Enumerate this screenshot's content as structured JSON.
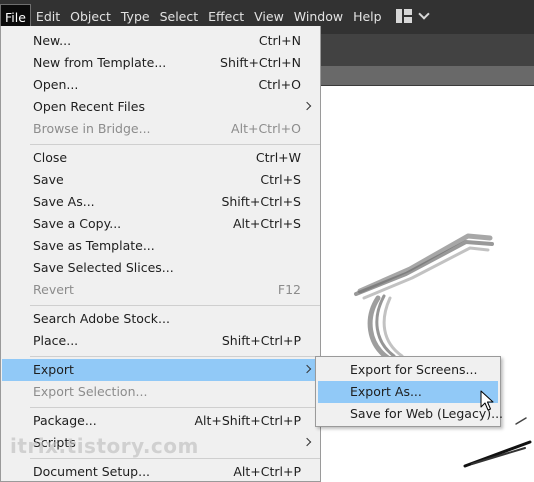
{
  "menubar": {
    "items": [
      "File",
      "Edit",
      "Object",
      "Type",
      "Select",
      "Effect",
      "View",
      "Window",
      "Help"
    ],
    "active": "File",
    "workspace_icon": "workspace-layout-icon"
  },
  "file_menu": {
    "items": [
      {
        "label": "New...",
        "shortcut": "Ctrl+N",
        "state": "enabled"
      },
      {
        "label": "New from Template...",
        "shortcut": "Shift+Ctrl+N",
        "state": "enabled"
      },
      {
        "label": "Open...",
        "shortcut": "Ctrl+O",
        "state": "enabled"
      },
      {
        "label": "Open Recent Files",
        "shortcut": "",
        "submenu": true,
        "state": "enabled"
      },
      {
        "label": "Browse in Bridge...",
        "shortcut": "Alt+Ctrl+O",
        "state": "disabled"
      },
      {
        "label": "Close",
        "shortcut": "Ctrl+W",
        "state": "enabled"
      },
      {
        "label": "Save",
        "shortcut": "Ctrl+S",
        "state": "enabled"
      },
      {
        "label": "Save As...",
        "shortcut": "Shift+Ctrl+S",
        "state": "enabled"
      },
      {
        "label": "Save a Copy...",
        "shortcut": "Alt+Ctrl+S",
        "state": "enabled"
      },
      {
        "label": "Save as Template...",
        "shortcut": "",
        "state": "enabled"
      },
      {
        "label": "Save Selected Slices...",
        "shortcut": "",
        "state": "enabled"
      },
      {
        "label": "Revert",
        "shortcut": "F12",
        "state": "disabled"
      },
      {
        "label": "Search Adobe Stock...",
        "shortcut": "",
        "state": "enabled"
      },
      {
        "label": "Place...",
        "shortcut": "Shift+Ctrl+P",
        "state": "enabled"
      },
      {
        "label": "Export",
        "shortcut": "",
        "submenu": true,
        "state": "highlighted"
      },
      {
        "label": "Export Selection...",
        "shortcut": "",
        "state": "disabled"
      },
      {
        "label": "Package...",
        "shortcut": "Alt+Shift+Ctrl+P",
        "state": "enabled"
      },
      {
        "label": "Scripts",
        "shortcut": "",
        "submenu": true,
        "state": "enabled"
      },
      {
        "label": "Document Setup...",
        "shortcut": "Alt+Ctrl+P",
        "state": "enabled"
      }
    ]
  },
  "export_submenu": {
    "items": [
      {
        "label": "Export for Screens...",
        "state": "enabled"
      },
      {
        "label": "Export As...",
        "state": "highlighted"
      },
      {
        "label": "Save for Web (Legacy)...",
        "state": "enabled"
      }
    ]
  },
  "watermark": "itrix.tistory.com",
  "colors": {
    "menubar_bg": "#323232",
    "menu_bg": "#f0f0f0",
    "highlight": "#91c9f7",
    "disabled_text": "#8c8c8c"
  }
}
